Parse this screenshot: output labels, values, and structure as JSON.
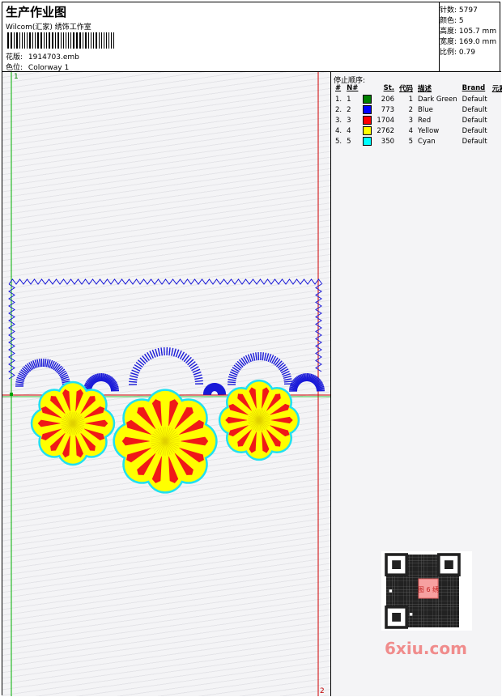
{
  "header": {
    "title": "生产作业图",
    "subtitle": "Wilcom(汇家) 绣饰工作室",
    "design_label": "花版:",
    "design_value": "1914703.emb",
    "colorway_label": "色位:",
    "colorway_value": "Colorway 1"
  },
  "stats": [
    {
      "label": "针数:",
      "value": "5797"
    },
    {
      "label": "颜色:",
      "value": "5"
    },
    {
      "label": "高度:",
      "value": "105.7 mm"
    },
    {
      "label": "宽度:",
      "value": "169.0 mm"
    },
    {
      "label": "比例:",
      "value": "0.79"
    }
  ],
  "stop_sequence": {
    "title": "停止顺序:",
    "columns": [
      "#",
      "N#",
      "St.",
      "代码",
      "描述",
      "Brand",
      "元素"
    ],
    "rows": [
      {
        "num": "1.",
        "n": "1",
        "color": "#008000",
        "st": "206",
        "code": "1",
        "desc": "Dark Green",
        "brand": "Default"
      },
      {
        "num": "2.",
        "n": "2",
        "color": "#0000ff",
        "st": "773",
        "code": "2",
        "desc": "Blue",
        "brand": "Default"
      },
      {
        "num": "3.",
        "n": "3",
        "color": "#ff0000",
        "st": "1704",
        "code": "3",
        "desc": "Red",
        "brand": "Default"
      },
      {
        "num": "4.",
        "n": "4",
        "color": "#ffff00",
        "st": "2762",
        "code": "4",
        "desc": "Yellow",
        "brand": "Default"
      },
      {
        "num": "5.",
        "n": "5",
        "color": "#00ffff",
        "st": "350",
        "code": "5",
        "desc": "Cyan",
        "brand": "Default"
      }
    ]
  },
  "canvas": {
    "marker_start": "1",
    "marker_end": "2",
    "colors": {
      "blue": "#1a1ad8",
      "red": "#f01818",
      "yellow": "#ffff00",
      "cyan": "#20e0f0",
      "green": "#00a000"
    }
  },
  "watermark": {
    "text": "6xiu.com",
    "qr_text": "图 6 绣"
  }
}
